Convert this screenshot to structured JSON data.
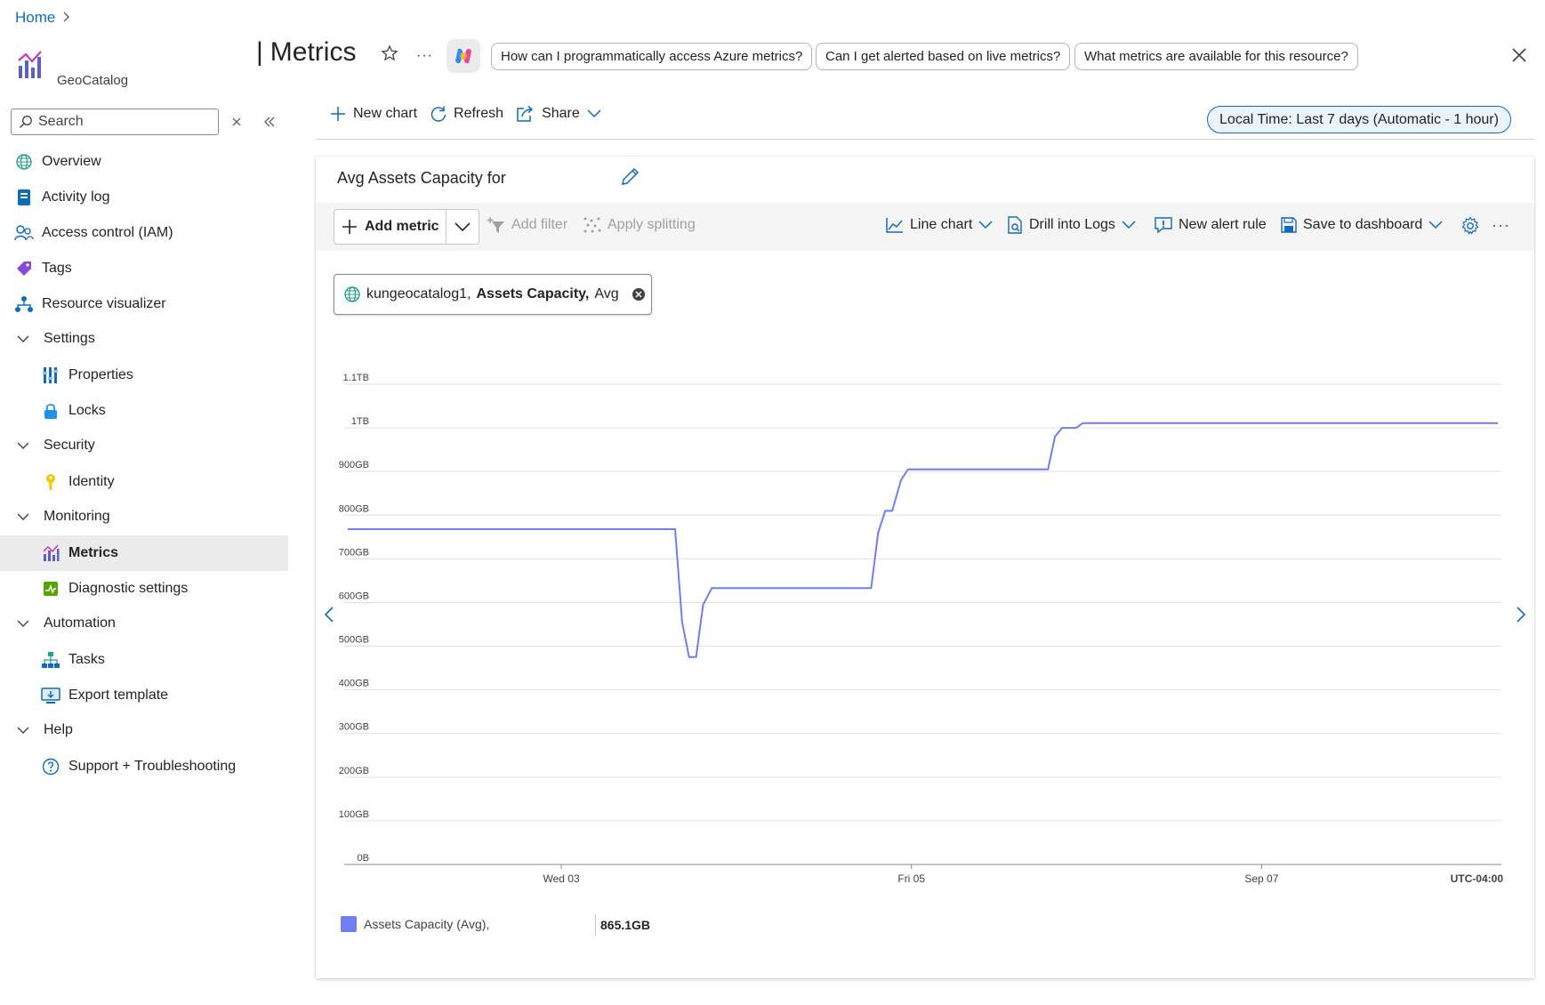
{
  "breadcrumb": {
    "home": "Home"
  },
  "resource": {
    "subtitle": "GeoCatalog"
  },
  "page": {
    "title": "Metrics"
  },
  "copilot_prompts": [
    "How can I programmatically access Azure metrics?",
    "Can I get alerted based on live metrics?",
    "What metrics are available for this resource?"
  ],
  "sidebar": {
    "search_placeholder": "Search",
    "items": {
      "overview": "Overview",
      "activity_log": "Activity log",
      "access_control": "Access control (IAM)",
      "tags": "Tags",
      "resource_visualizer": "Resource visualizer",
      "settings": "Settings",
      "properties": "Properties",
      "locks": "Locks",
      "security": "Security",
      "identity": "Identity",
      "monitoring": "Monitoring",
      "metrics": "Metrics",
      "diagnostic_settings": "Diagnostic settings",
      "automation": "Automation",
      "tasks": "Tasks",
      "export_template": "Export template",
      "help": "Help",
      "support": "Support + Troubleshooting"
    }
  },
  "toolbar": {
    "new_chart": "New chart",
    "refresh": "Refresh",
    "share": "Share",
    "time_range": "Local Time: Last 7 days (Automatic - 1 hour)"
  },
  "chart_card": {
    "title": "Avg Assets Capacity for",
    "add_metric": "Add metric",
    "add_filter": "Add filter",
    "apply_splitting": "Apply splitting",
    "line_chart": "Line chart",
    "drill_into_logs": "Drill into Logs",
    "new_alert_rule": "New alert rule",
    "save_to_dashboard": "Save to dashboard",
    "metric_pill": {
      "resource": "kungeocatalog1,",
      "metric": "Assets Capacity,",
      "aggregation": "Avg"
    }
  },
  "colors": {
    "accent": "#0f6cbd",
    "series": "#6f7ff2"
  },
  "chart_data": {
    "type": "line",
    "y_ticks": [
      "0B",
      "100GB",
      "200GB",
      "300GB",
      "400GB",
      "500GB",
      "600GB",
      "700GB",
      "800GB",
      "900GB",
      "1TB",
      "1.1TB"
    ],
    "x_ticks": [
      {
        "label": "Wed 03",
        "day": 1.0
      },
      {
        "label": "Fri 05",
        "day": 3.0
      },
      {
        "label": "Sep 07",
        "day": 5.0
      }
    ],
    "timezone_label": "UTC-04:00",
    "ylim_gb": [
      0,
      1100
    ],
    "xlim_days": [
      -0.24,
      6.37
    ],
    "series": [
      {
        "name": "Assets Capacity (Avg),",
        "summary": "865.1GB",
        "points": [
          [
            -0.22,
            768
          ],
          [
            1.65,
            768
          ],
          [
            1.69,
            555
          ],
          [
            1.73,
            475
          ],
          [
            1.77,
            475
          ],
          [
            1.81,
            595
          ],
          [
            1.86,
            633
          ],
          [
            2.77,
            633
          ],
          [
            2.81,
            760
          ],
          [
            2.85,
            810
          ],
          [
            2.89,
            810
          ],
          [
            2.94,
            880
          ],
          [
            2.98,
            905
          ],
          [
            3.78,
            905
          ],
          [
            3.82,
            980
          ],
          [
            3.86,
            1000
          ],
          [
            3.94,
            1000
          ],
          [
            3.98,
            1011
          ],
          [
            6.35,
            1011
          ]
        ]
      }
    ]
  }
}
